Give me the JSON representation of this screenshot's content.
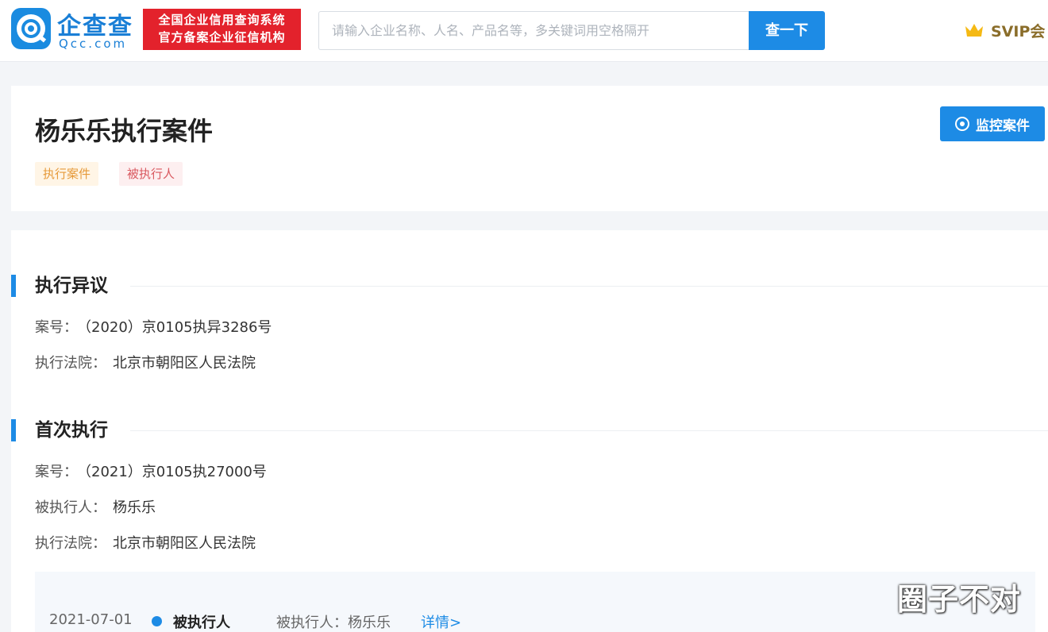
{
  "header": {
    "logo_cn": "企查查",
    "logo_en": "Qcc.com",
    "badge_line1": "全国企业信用查询系统",
    "badge_line2": "官方备案企业征信机构",
    "search_placeholder": "请输入企业名称、人名、产品名等，多关键词用空格隔开",
    "search_button": "查一下",
    "vip_label": "SVIP会"
  },
  "title_card": {
    "title": "杨乐乐执行案件",
    "tags": [
      "执行案件",
      "被执行人"
    ],
    "monitor_button": "监控案件"
  },
  "sections": [
    {
      "title": "执行异议",
      "fields": [
        {
          "label": "案号：",
          "value": "（2020）京0105执异3286号"
        },
        {
          "label": "执行法院：",
          "value": "北京市朝阳区人民法院"
        }
      ]
    },
    {
      "title": "首次执行",
      "fields": [
        {
          "label": "案号：",
          "value": "（2021）京0105执27000号"
        },
        {
          "label": "被执行人：",
          "value": "杨乐乐"
        },
        {
          "label": "执行法院：",
          "value": "北京市朝阳区人民法院"
        }
      ]
    }
  ],
  "timeline": {
    "date": "2021-07-01",
    "type": "被执行人",
    "info": "被执行人：杨乐乐",
    "link": "详情>"
  },
  "watermark": "圈子不对",
  "colors": {
    "brand_blue": "#1d8be5",
    "badge_red": "#e3222c",
    "tag_orange": "#e69a3a",
    "tag_red": "#d9585f"
  }
}
